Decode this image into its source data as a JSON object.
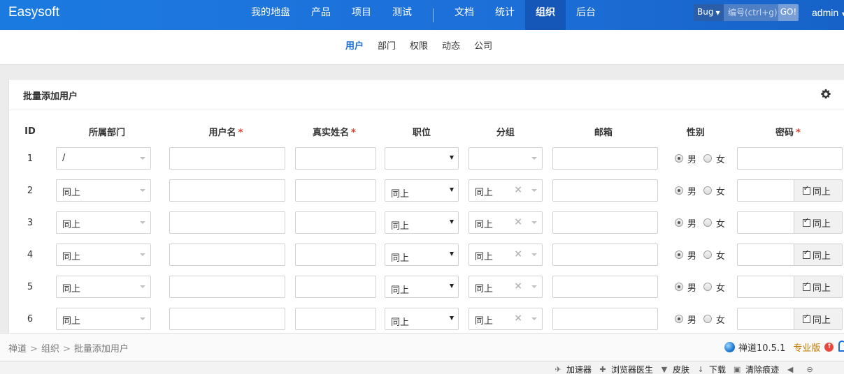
{
  "brand": "Easysoft",
  "nav": {
    "items_left": [
      "我的地盘",
      "产品",
      "项目",
      "测试"
    ],
    "items_right": [
      "文档",
      "统计",
      "组织",
      "后台"
    ],
    "active": "组织"
  },
  "search": {
    "type": "Bug",
    "placeholder": "编号(ctrl+g)",
    "go_label": "GO!"
  },
  "user": "admin",
  "subnav": {
    "items": [
      "用户",
      "部门",
      "权限",
      "动态",
      "公司"
    ],
    "active": "用户"
  },
  "panel": {
    "title": "批量添加用户"
  },
  "table": {
    "headers": {
      "id": "ID",
      "dept": "所属部门",
      "account": "用户名",
      "realname": "真实姓名",
      "role": "职位",
      "group": "分组",
      "email": "邮箱",
      "gender": "性别",
      "password": "密码"
    },
    "required_mark": "*",
    "gender_male": "男",
    "gender_female": "女",
    "same_label": "同上",
    "rows": [
      {
        "id": "1",
        "dept": "/",
        "role": "",
        "group": "",
        "gender": "男",
        "same": false
      },
      {
        "id": "2",
        "dept": "同上",
        "role": "同上",
        "group": "同上",
        "gender": "男",
        "same": true
      },
      {
        "id": "3",
        "dept": "同上",
        "role": "同上",
        "group": "同上",
        "gender": "男",
        "same": true
      },
      {
        "id": "4",
        "dept": "同上",
        "role": "同上",
        "group": "同上",
        "gender": "男",
        "same": true
      },
      {
        "id": "5",
        "dept": "同上",
        "role": "同上",
        "group": "同上",
        "gender": "男",
        "same": true
      },
      {
        "id": "6",
        "dept": "同上",
        "role": "同上",
        "group": "同上",
        "gender": "男",
        "same": true
      }
    ]
  },
  "footer": {
    "breadcrumb": [
      "禅道",
      "组织",
      "批量添加用户"
    ],
    "version": "禅道10.5.1",
    "edition": "专业版"
  },
  "statusbar": {
    "tools": [
      "加速器",
      "浏览器医生",
      "皮肤",
      "下载",
      "清除痕迹"
    ]
  },
  "colors": {
    "topbar": "#1b7ae0",
    "active_nav": "#1557b8",
    "accent": "#1a6fd8",
    "required": "#e8382c",
    "pro": "#c67b00"
  }
}
